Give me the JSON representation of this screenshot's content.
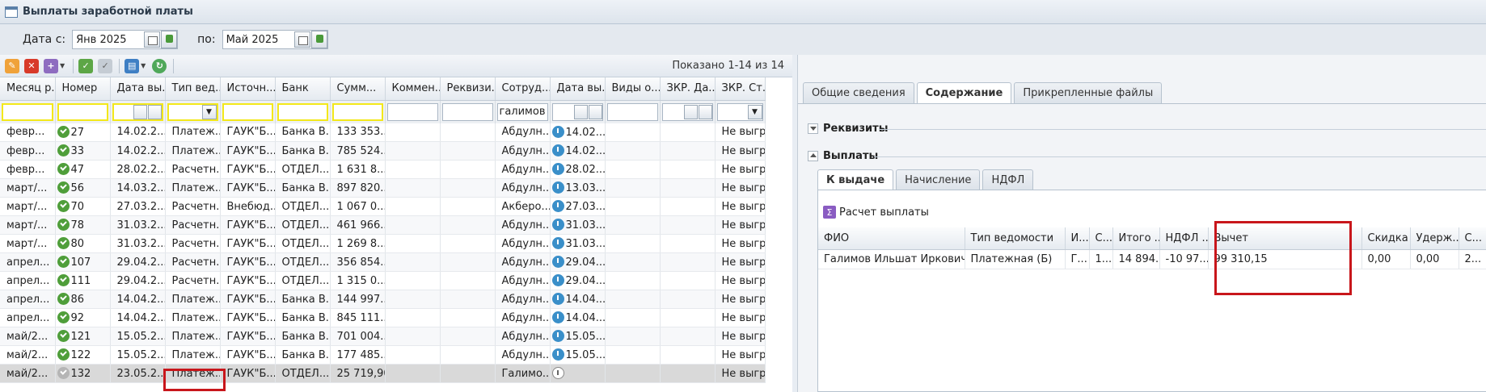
{
  "window": {
    "title": "Выплаты заработной платы"
  },
  "filters": {
    "date_from_label": "Дата с:",
    "date_from": "Янв 2025",
    "date_to_label": "по:",
    "date_to": "Май 2025"
  },
  "toolbar": {
    "shown": "Показано 1-14 из 14"
  },
  "grid": {
    "columns": [
      "Месяц р...",
      "Номер",
      "Дата вы...",
      "Тип вед...",
      "Источн...",
      "Банк",
      "Сумм...",
      "Коммен...",
      "Реквизи...",
      "Сотруд...",
      "Дата вы...",
      "Виды о...",
      "ЗКР. Да...",
      "ЗКР. Ст..."
    ],
    "employee_filter": "галимов",
    "rows": [
      {
        "month": "февр...",
        "num": "27",
        "date": "14.02.2...",
        "type": "Платеж...",
        "source": "ГАУК\"Б...",
        "bank": "Банка В...",
        "sum": "133 353...",
        "comment": "",
        "req": "",
        "emp": "Абдулн...",
        "pay_date": "14.02...",
        "kinds": "",
        "zkr_date": "",
        "zkr_status": "Не выгр..."
      },
      {
        "month": "февр...",
        "num": "33",
        "date": "14.02.2...",
        "type": "Платеж...",
        "source": "ГАУК\"Б...",
        "bank": "Банка В...",
        "sum": "785 524...",
        "comment": "",
        "req": "",
        "emp": "Абдулн...",
        "pay_date": "14.02...",
        "kinds": "",
        "zkr_date": "",
        "zkr_status": "Не выгр..."
      },
      {
        "month": "февр...",
        "num": "47",
        "date": "28.02.2...",
        "type": "Расчетн...",
        "source": "ГАУК\"Б...",
        "bank": "ОТДЕЛ...",
        "sum": "1 631 8...",
        "comment": "",
        "req": "",
        "emp": "Абдулн...",
        "pay_date": "28.02...",
        "kinds": "",
        "zkr_date": "",
        "zkr_status": "Не выгр..."
      },
      {
        "month": "март/...",
        "num": "56",
        "date": "14.03.2...",
        "type": "Платеж...",
        "source": "ГАУК\"Б...",
        "bank": "Банка В...",
        "sum": "897 820...",
        "comment": "",
        "req": "",
        "emp": "Абдулн...",
        "pay_date": "13.03...",
        "kinds": "",
        "zkr_date": "",
        "zkr_status": "Не выгр..."
      },
      {
        "month": "март/...",
        "num": "70",
        "date": "27.03.2...",
        "type": "Расчетн...",
        "source": "Внебюд...",
        "bank": "ОТДЕЛ...",
        "sum": "1 067 0...",
        "comment": "",
        "req": "",
        "emp": "Акберо...",
        "pay_date": "27.03...",
        "kinds": "",
        "zkr_date": "",
        "zkr_status": "Не выгр..."
      },
      {
        "month": "март/...",
        "num": "78",
        "date": "31.03.2...",
        "type": "Расчетн...",
        "source": "ГАУК\"Б...",
        "bank": "ОТДЕЛ...",
        "sum": "461 966...",
        "comment": "",
        "req": "",
        "emp": "Абдулн...",
        "pay_date": "31.03...",
        "kinds": "",
        "zkr_date": "",
        "zkr_status": "Не выгр..."
      },
      {
        "month": "март/...",
        "num": "80",
        "date": "31.03.2...",
        "type": "Расчетн...",
        "source": "ГАУК\"Б...",
        "bank": "ОТДЕЛ...",
        "sum": "1 269 8...",
        "comment": "",
        "req": "",
        "emp": "Абдулн...",
        "pay_date": "31.03...",
        "kinds": "",
        "zkr_date": "",
        "zkr_status": "Не выгр..."
      },
      {
        "month": "апрел...",
        "num": "107",
        "date": "29.04.2...",
        "type": "Расчетн...",
        "source": "ГАУК\"Б...",
        "bank": "ОТДЕЛ...",
        "sum": "356 854...",
        "comment": "",
        "req": "",
        "emp": "Абдулн...",
        "pay_date": "29.04...",
        "kinds": "",
        "zkr_date": "",
        "zkr_status": "Не выгр..."
      },
      {
        "month": "апрел...",
        "num": "111",
        "date": "29.04.2...",
        "type": "Расчетн...",
        "source": "ГАУК\"Б...",
        "bank": "ОТДЕЛ...",
        "sum": "1 315 0...",
        "comment": "",
        "req": "",
        "emp": "Абдулн...",
        "pay_date": "29.04...",
        "kinds": "",
        "zkr_date": "",
        "zkr_status": "Не выгр..."
      },
      {
        "month": "апрел...",
        "num": "86",
        "date": "14.04.2...",
        "type": "Платеж...",
        "source": "ГАУК\"Б...",
        "bank": "Банка В...",
        "sum": "144 997...",
        "comment": "",
        "req": "",
        "emp": "Абдулн...",
        "pay_date": "14.04...",
        "kinds": "",
        "zkr_date": "",
        "zkr_status": "Не выгр..."
      },
      {
        "month": "апрел...",
        "num": "92",
        "date": "14.04.2...",
        "type": "Платеж...",
        "source": "ГАУК\"Б...",
        "bank": "Банка В...",
        "sum": "845 111...",
        "comment": "",
        "req": "",
        "emp": "Абдулн...",
        "pay_date": "14.04...",
        "kinds": "",
        "zkr_date": "",
        "zkr_status": "Не выгр..."
      },
      {
        "month": "май/2...",
        "num": "121",
        "date": "15.05.2...",
        "type": "Платеж...",
        "source": "ГАУК\"Б...",
        "bank": "Банка В...",
        "sum": "701 004...",
        "comment": "",
        "req": "",
        "emp": "Абдулн...",
        "pay_date": "15.05...",
        "kinds": "",
        "zkr_date": "",
        "zkr_status": "Не выгр..."
      },
      {
        "month": "май/2...",
        "num": "122",
        "date": "15.05.2...",
        "type": "Платеж...",
        "source": "ГАУК\"Б...",
        "bank": "Банка В...",
        "sum": "177 485...",
        "comment": "",
        "req": "",
        "emp": "Абдулн...",
        "pay_date": "15.05...",
        "kinds": "",
        "zkr_date": "",
        "zkr_status": "Не выгр..."
      },
      {
        "month": "май/2...",
        "num": "132",
        "date": "23.05.2...",
        "type": "Платеж...",
        "source": "ГАУК\"Б...",
        "bank": "ОТДЕЛ...",
        "sum": "25 719,90",
        "comment": "",
        "req": "",
        "emp": "Галимо...",
        "pay_date": "",
        "kinds": "",
        "zkr_date": "",
        "zkr_status": "Не выгр...",
        "selected": true
      }
    ]
  },
  "right": {
    "tabs": [
      "Общие сведения",
      "Содержание",
      "Прикрепленные файлы"
    ],
    "active_tab": "Содержание",
    "section_requisites": "Реквизиты",
    "section_payments": "Выплаты",
    "subtabs": [
      "К выдаче",
      "Начисление",
      "НДФЛ"
    ],
    "calc_button": "Расчет выплаты",
    "columns": [
      "ФИО",
      "Тип ведомости",
      "И...",
      "С...",
      "Итого ...",
      "НДФЛ ...",
      "Вычет",
      "Скидка",
      "Удерж...",
      "С..."
    ],
    "row": [
      "Галимов Ильшат Иркович",
      "Платежная (Б)",
      "Г...",
      "1...",
      "14 894...",
      "-10 97...",
      "99 310,15",
      "0,00",
      "0,00",
      "2..."
    ]
  },
  "colors": {
    "highlight": "#c8161b",
    "filter_border": "#f3e81a"
  }
}
